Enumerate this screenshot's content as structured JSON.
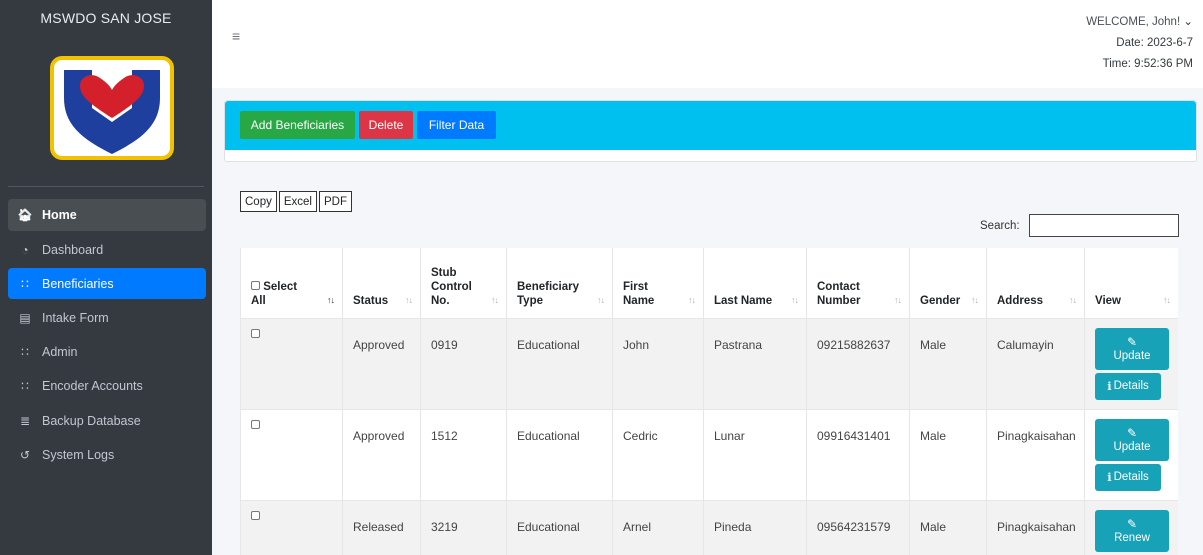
{
  "sidebar": {
    "brand": "MSWDO SAN JOSE",
    "items": [
      {
        "label": "Home",
        "icon": "home-icon"
      },
      {
        "label": "Dashboard",
        "icon": "dashboard-icon"
      },
      {
        "label": "Beneficiaries",
        "icon": "users-icon"
      },
      {
        "label": "Intake Form",
        "icon": "file-icon"
      },
      {
        "label": "Admin",
        "icon": "users-icon"
      },
      {
        "label": "Encoder Accounts",
        "icon": "users-icon"
      },
      {
        "label": "Backup Database",
        "icon": "database-icon"
      },
      {
        "label": "System Logs",
        "icon": "history-icon"
      }
    ]
  },
  "header": {
    "welcome": "WELCOME, John!",
    "date": "Date: 2023-6-7",
    "time": "Time: 9:52:36 PM"
  },
  "toolbar": {
    "add_label": "Add Beneficiaries",
    "delete_label": "Delete",
    "filter_label": "Filter Data"
  },
  "exports": {
    "copy": "Copy",
    "excel": "Excel",
    "pdf": "PDF"
  },
  "search": {
    "label": "Search:",
    "value": ""
  },
  "table": {
    "headers": {
      "select_line1": "Select",
      "select_line2": "All",
      "status": "Status",
      "stub_line1": "Stub",
      "stub_line2": "Control",
      "stub_line3": "No.",
      "type_line1": "Beneficiary",
      "type_line2": "Type",
      "first_line1": "First",
      "first_line2": "Name",
      "last": "Last Name",
      "contact_line1": "Contact",
      "contact_line2": "Number",
      "gender": "Gender",
      "address": "Address",
      "view": "View"
    },
    "rows": [
      {
        "status": "Approved",
        "stub": "0919",
        "type": "Educational",
        "first": "John",
        "last": "Pastrana",
        "contact": "09215882637",
        "gender": "Male",
        "address": "Calumayin",
        "action": "Update",
        "details": "Details"
      },
      {
        "status": "Approved",
        "stub": "1512",
        "type": "Educational",
        "first": "Cedric",
        "last": "Lunar",
        "contact": "09916431401",
        "gender": "Male",
        "address": "Pinagkaisahan",
        "action": "Update",
        "details": "Details"
      },
      {
        "status": "Released",
        "stub": "3219",
        "type": "Educational",
        "first": "Arnel",
        "last": "Pineda",
        "contact": "09564231579",
        "gender": "Male",
        "address": "Pinagkaisahan",
        "action": "Renew"
      }
    ]
  },
  "colors": {
    "sidebar": "#343a40",
    "accent": "#007bff",
    "toolbar": "#00c0ef",
    "success": "#28a745",
    "danger": "#dc3545",
    "info": "#17a2b8"
  }
}
